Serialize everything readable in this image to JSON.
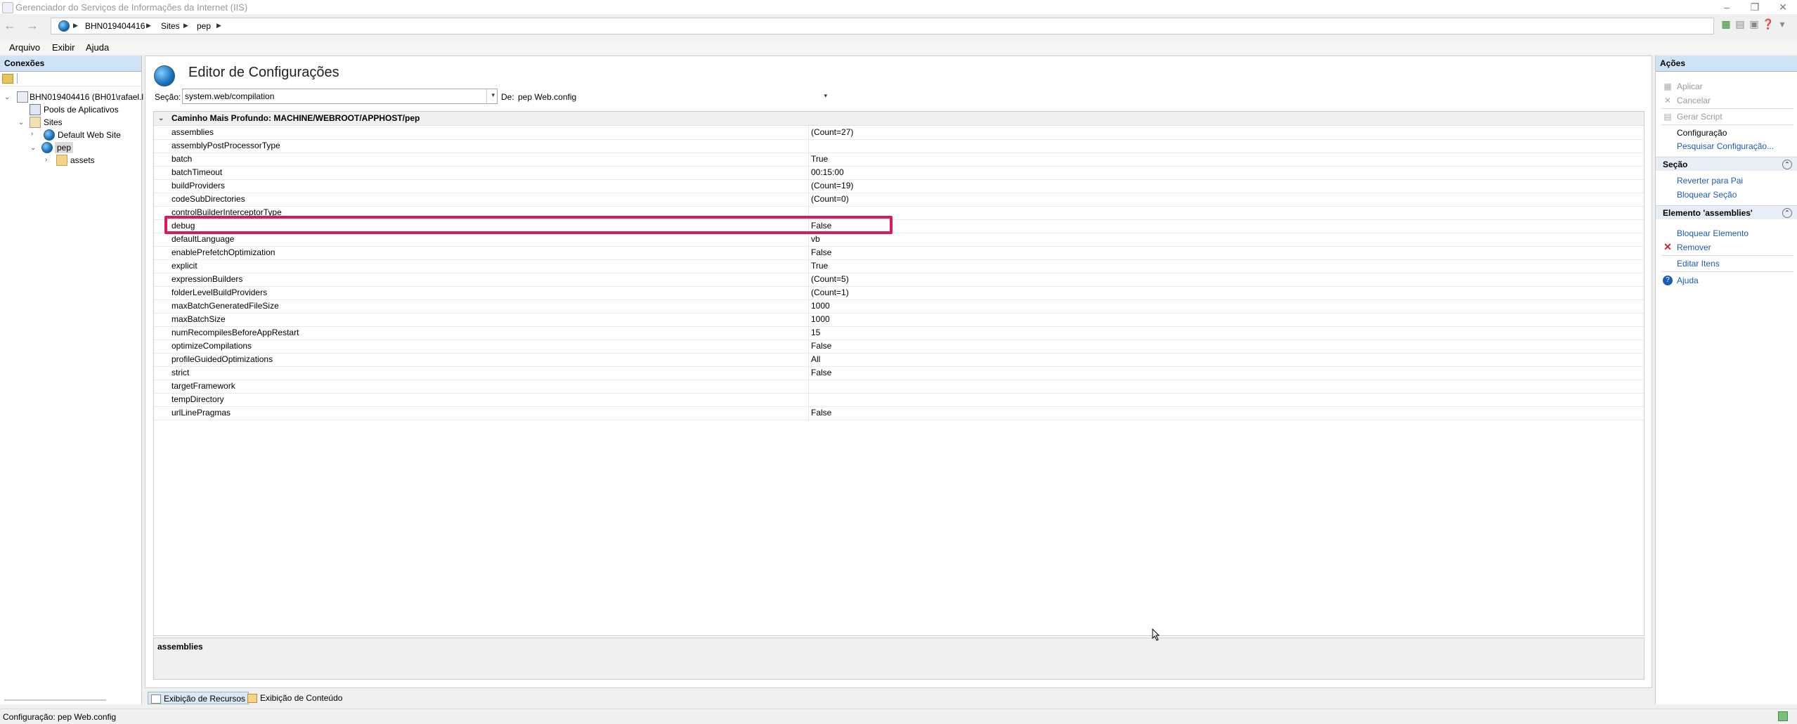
{
  "window": {
    "title": "Gerenciador do Serviços de Informações da Internet (IIS)"
  },
  "address": {
    "crumbs": [
      "BHN019404416",
      "Sites",
      "pep"
    ]
  },
  "menu": [
    "Arquivo",
    "Exibir",
    "Ajuda"
  ],
  "connections": {
    "header": "Conexões",
    "tree": [
      {
        "label": "BHN019404416 (BH01\\rafael.l",
        "level": 0,
        "expanded": true
      },
      {
        "label": "Pools de Aplicativos",
        "level": 1,
        "expanded": null
      },
      {
        "label": "Sites",
        "level": 1,
        "expanded": true
      },
      {
        "label": "Default Web Site",
        "level": 2,
        "expanded": false
      },
      {
        "label": "pep",
        "level": 2,
        "expanded": true,
        "selected": true
      },
      {
        "label": "assets",
        "level": 3,
        "expanded": false
      }
    ]
  },
  "editor": {
    "title": "Editor de Configurações",
    "section_label": "Seção:",
    "section_value": "system.web/compilation",
    "from_label": "De:",
    "from_value": "pep Web.config",
    "group_header": "Caminho Mais Profundo: MACHINE/WEBROOT/APPHOST/pep",
    "rows": [
      {
        "name": "assemblies",
        "value": "(Count=27)"
      },
      {
        "name": "assemblyPostProcessorType",
        "value": ""
      },
      {
        "name": "batch",
        "value": "True"
      },
      {
        "name": "batchTimeout",
        "value": "00:15:00"
      },
      {
        "name": "buildProviders",
        "value": "(Count=19)"
      },
      {
        "name": "codeSubDirectories",
        "value": "(Count=0)"
      },
      {
        "name": "controlBuilderInterceptorType",
        "value": ""
      },
      {
        "name": "debug",
        "value": "False"
      },
      {
        "name": "defaultLanguage",
        "value": "vb"
      },
      {
        "name": "enablePrefetchOptimization",
        "value": "False"
      },
      {
        "name": "explicit",
        "value": "True"
      },
      {
        "name": "expressionBuilders",
        "value": "(Count=5)"
      },
      {
        "name": "folderLevelBuildProviders",
        "value": "(Count=1)"
      },
      {
        "name": "maxBatchGeneratedFileSize",
        "value": "1000"
      },
      {
        "name": "maxBatchSize",
        "value": "1000"
      },
      {
        "name": "numRecompilesBeforeAppRestart",
        "value": "15"
      },
      {
        "name": "optimizeCompilations",
        "value": "False"
      },
      {
        "name": "profileGuidedOptimizations",
        "value": "All"
      },
      {
        "name": "strict",
        "value": "False"
      },
      {
        "name": "targetFramework",
        "value": ""
      },
      {
        "name": "tempDirectory",
        "value": ""
      },
      {
        "name": "urlLinePragmas",
        "value": "False"
      }
    ],
    "description_title": "assemblies"
  },
  "bottom_tabs": {
    "features": "Exibição de Recursos",
    "content": "Exibição de Conteúdo"
  },
  "actions": {
    "header": "Ações",
    "apply": "Aplicar",
    "cancel": "Cancelar",
    "generate_script": "Gerar Script",
    "configuration": "Configuração",
    "search_configuration": "Pesquisar Configuração...",
    "section_header": "Seção",
    "revert_to_parent": "Reverter para Pai",
    "lock_section": "Bloquear Seção",
    "element_header": "Elemento 'assemblies'",
    "lock_element": "Bloquear Elemento",
    "remove": "Remover",
    "edit_items": "Editar Itens",
    "help": "Ajuda"
  },
  "status": {
    "text": "Configuração: pep Web.config"
  },
  "colors": {
    "highlight": "#d81b5a",
    "link": "#1c5bb6",
    "panel_header": "#cfe3f7"
  }
}
